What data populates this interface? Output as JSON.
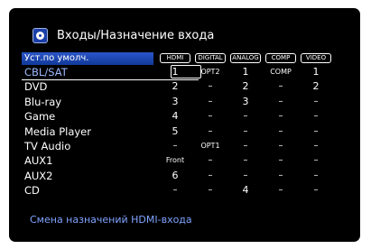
{
  "header": {
    "icon": "input-icon",
    "title": "Входы/Назначение входа"
  },
  "set_default_label": "Уст.по умолч.",
  "columns": [
    "HDMI",
    "DIGITAL",
    "ANALOG",
    "COMP",
    "VIDEO"
  ],
  "rows": [
    {
      "label": "CBL/SAT",
      "values": [
        "1",
        "OPT2",
        "1",
        "COMP",
        "1"
      ]
    },
    {
      "label": "DVD",
      "values": [
        "2",
        "–",
        "2",
        "–",
        "2"
      ]
    },
    {
      "label": "Blu-ray",
      "values": [
        "3",
        "–",
        "3",
        "–",
        "–"
      ]
    },
    {
      "label": "Game",
      "values": [
        "4",
        "–",
        "–",
        "–",
        "–"
      ]
    },
    {
      "label": "Media Player",
      "values": [
        "5",
        "–",
        "–",
        "–",
        "–"
      ]
    },
    {
      "label": "TV Audio",
      "values": [
        "–",
        "OPT1",
        "–",
        "–",
        "–"
      ]
    },
    {
      "label": "AUX1",
      "values": [
        "Front",
        "–",
        "–",
        "–",
        "–"
      ]
    },
    {
      "label": "AUX2",
      "values": [
        "6",
        "–",
        "–",
        "–",
        "–"
      ]
    },
    {
      "label": "CD",
      "values": [
        "–",
        "–",
        "4",
        "–",
        "–"
      ]
    }
  ],
  "footer": "Смена назначений HDMI-входа",
  "colors": {
    "background": "#000000",
    "highlight": "#1f4bbf",
    "selected_text": "#9db8ff",
    "footer_text": "#7fa3ff"
  }
}
